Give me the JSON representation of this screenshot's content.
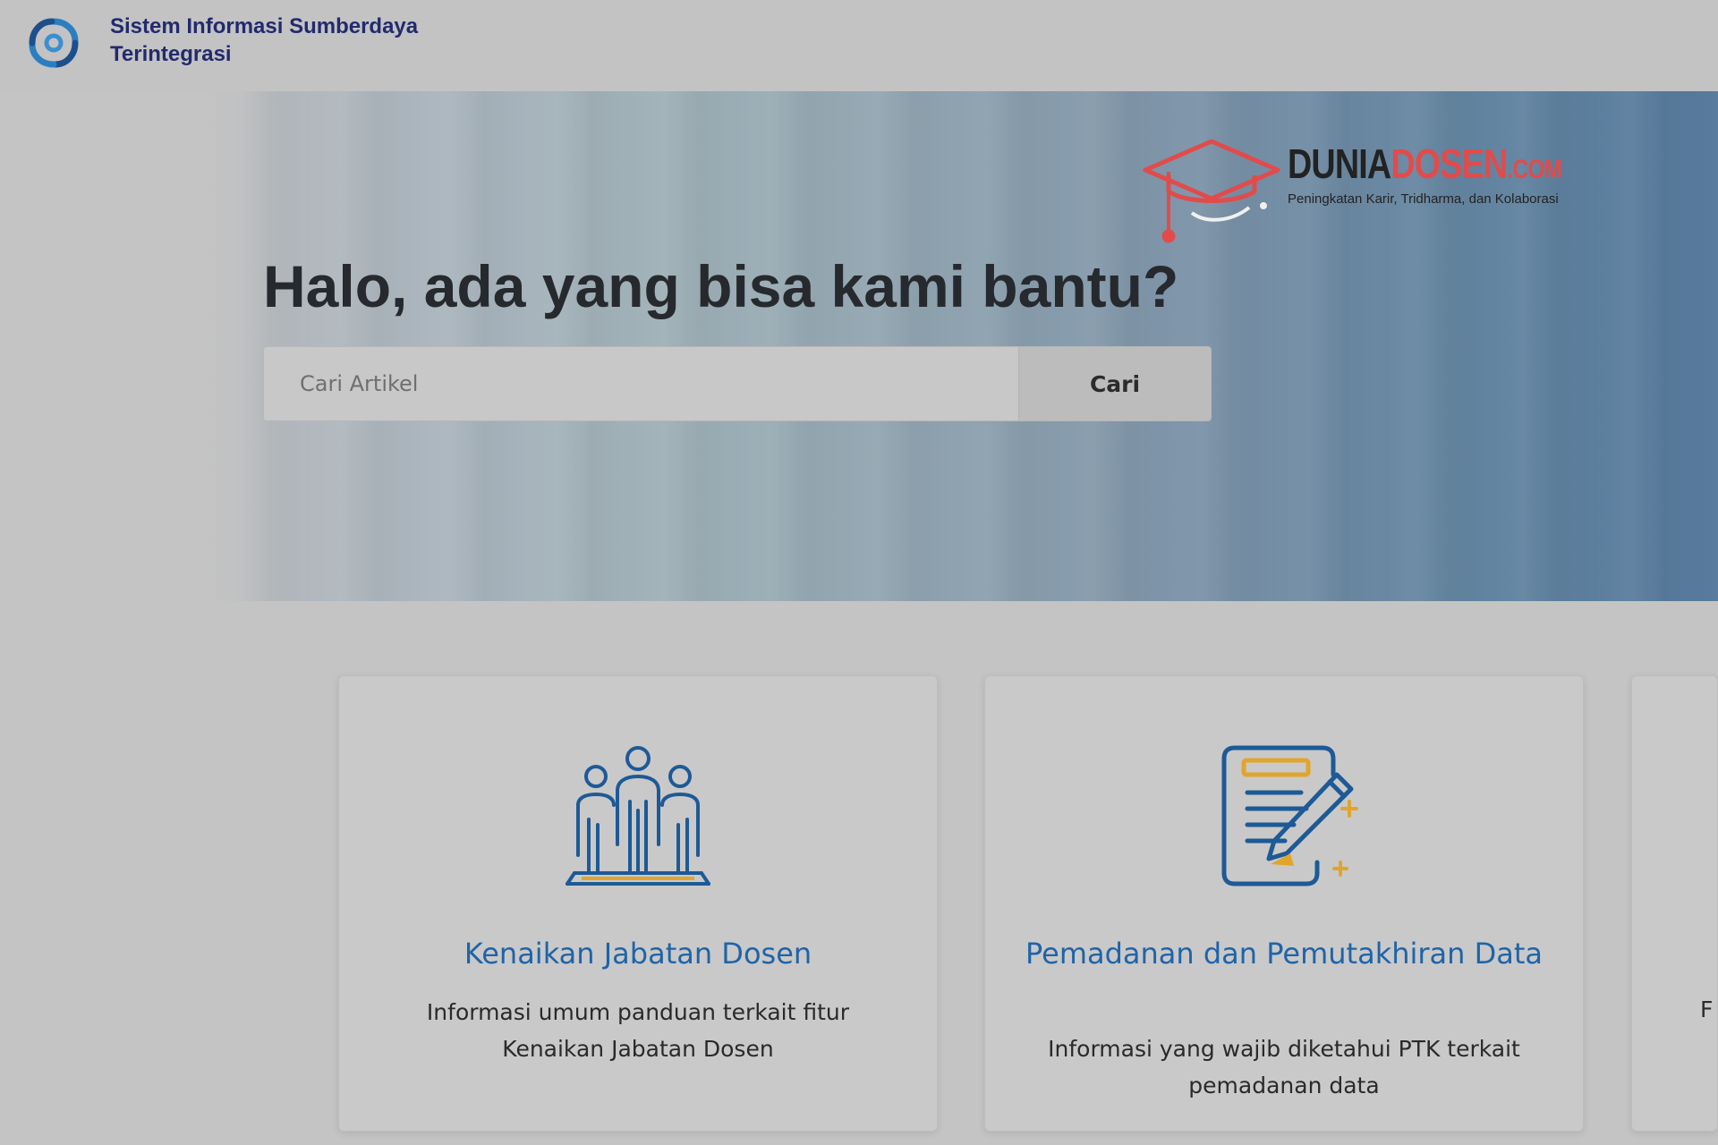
{
  "header": {
    "app_title_line1": "Sistem Informasi Sumberdaya",
    "app_title_line2": "Terintegrasi",
    "logo_icon": "sister-swirl-logo-icon"
  },
  "watermark": {
    "name_part1": "DUNIA",
    "name_part2": "DOSEN",
    "name_part3": ".COM",
    "tagline": "Peningkatan Karir, Tridharma, dan Kolaborasi",
    "icon": "graduation-cap-icon"
  },
  "hero": {
    "title": "Halo, ada yang bisa kami bantu?"
  },
  "search": {
    "placeholder": "Cari Artikel",
    "button_label": "Cari"
  },
  "cards": [
    {
      "icon": "people-group-icon",
      "title": "Kenaikan Jabatan Dosen",
      "description": "Informasi umum panduan terkait fitur Kenaikan Jabatan Dosen"
    },
    {
      "icon": "document-edit-icon",
      "title": "Pemadanan dan Pemutakhiran Data",
      "description": "Informasi yang wajib diketahui PTK terkait pemadanan data"
    },
    {
      "peek_text": "F"
    }
  ],
  "colors": {
    "accent_blue": "#1f64a8",
    "brand_navy": "#232a6e",
    "watermark_red": "#e24b4b"
  }
}
